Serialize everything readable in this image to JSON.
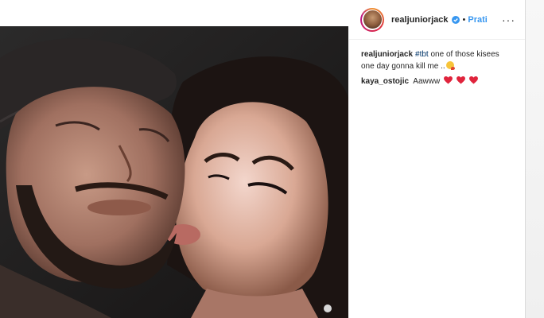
{
  "post": {
    "header": {
      "username": "realjuniorjack",
      "separator": "•",
      "follow_label": "Prati",
      "more_label": "···"
    },
    "caption": {
      "username": "realjuniorjack",
      "hashtag": "#tbt",
      "text": " one of those kisees one day gonna kill me ..",
      "emoji": "face-with-kiss-emoji"
    },
    "comments": [
      {
        "username": "kaya_ostojic",
        "text": "Aawww",
        "emoji": [
          "red-heart-emoji",
          "red-heart-emoji",
          "red-heart-emoji"
        ]
      }
    ],
    "colors": {
      "link_blue": "#3897f0",
      "hashtag": "#003569",
      "verified_badge": "#3897f0",
      "heart": "#e0243c",
      "text": "#262626"
    }
  }
}
